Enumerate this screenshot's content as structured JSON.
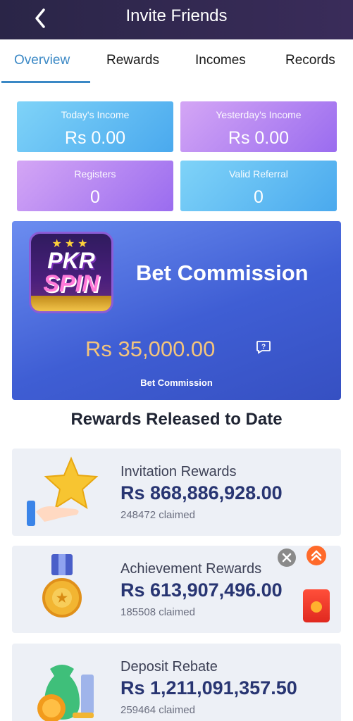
{
  "header": {
    "title": "Invite Friends"
  },
  "tabs": [
    {
      "label": "Overview"
    },
    {
      "label": "Rewards"
    },
    {
      "label": "Incomes"
    },
    {
      "label": "Records"
    }
  ],
  "stats": {
    "today_income_label": "Today's Income",
    "today_income_value": "Rs 0.00",
    "yesterday_income_label": "Yesterday's Income",
    "yesterday_income_value": "Rs 0.00",
    "registers_label": "Registers",
    "registers_value": "0",
    "valid_referral_label": "Valid Referral",
    "valid_referral_value": "0"
  },
  "commission": {
    "logo_line1": "PKR",
    "logo_line2": "SPIN",
    "title": "Bet Commission",
    "amount": "Rs 35,000.00",
    "subtitle": "Bet Commission",
    "amount_color": "#f3c47c"
  },
  "rewards_section": {
    "title": "Rewards Released to Date",
    "items": [
      {
        "title": "Invitation Rewards",
        "amount": "Rs 868,886,928.00",
        "claimed": "248472 claimed",
        "icon": "star-hand-icon"
      },
      {
        "title": "Achievement Rewards",
        "amount": "Rs 613,907,496.00",
        "claimed": "185508 claimed",
        "icon": "medal-icon"
      },
      {
        "title": "Deposit Rebate",
        "amount": "Rs 1,211,091,357.50",
        "claimed": "259464 claimed",
        "icon": "money-bag-icon"
      }
    ]
  },
  "colors": {
    "header_bg": "#2a2547",
    "accent": "#3a88c5",
    "amount_text": "#283572"
  }
}
